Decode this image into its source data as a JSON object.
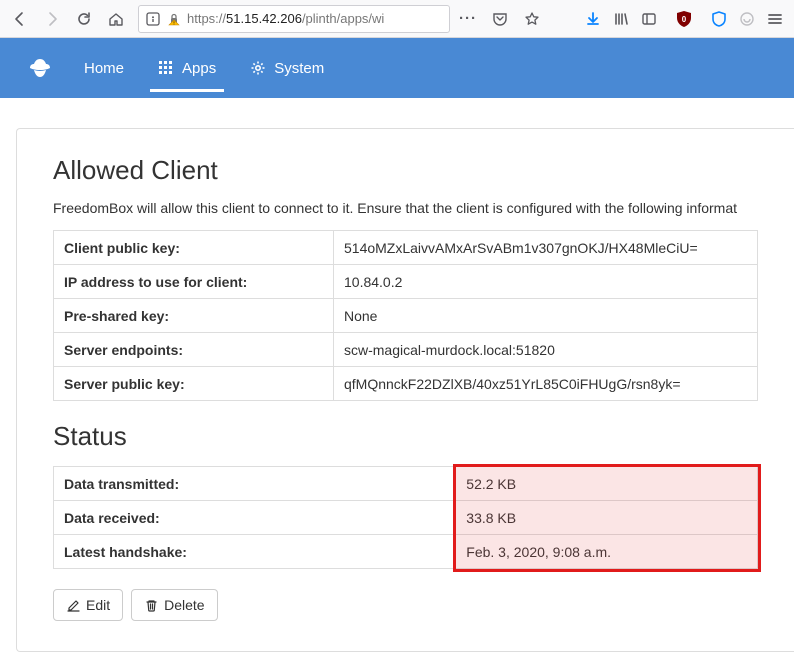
{
  "browser": {
    "url_prefix": "https://",
    "url_host": "51.15.42.206",
    "url_path": "/plinth/apps/wi"
  },
  "nav": {
    "home": "Home",
    "apps": "Apps",
    "system": "System"
  },
  "headings": {
    "allowed_client": "Allowed Client",
    "status": "Status"
  },
  "description": "FreedomBox will allow this client to connect to it. Ensure that the client is configured with the following informat",
  "client_table": {
    "rows": [
      {
        "label": "Client public key:",
        "value": "514oMZxLaivvAMxArSvABm1v307gnOKJ/HX48MleCiU="
      },
      {
        "label": "IP address to use for client:",
        "value": "10.84.0.2"
      },
      {
        "label": "Pre-shared key:",
        "value": "None"
      },
      {
        "label": "Server endpoints:",
        "value": "scw-magical-murdock.local:51820"
      },
      {
        "label": "Server public key:",
        "value": "qfMQnnckF22DZlXB/40xz51YrL85C0iFHUgG/rsn8yk="
      }
    ]
  },
  "status_table": {
    "rows": [
      {
        "label": "Data transmitted:",
        "value": "52.2 KB"
      },
      {
        "label": "Data received:",
        "value": "33.8 KB"
      },
      {
        "label": "Latest handshake:",
        "value": "Feb. 3, 2020, 9:08 a.m."
      }
    ]
  },
  "buttons": {
    "edit": "Edit",
    "delete": "Delete"
  }
}
